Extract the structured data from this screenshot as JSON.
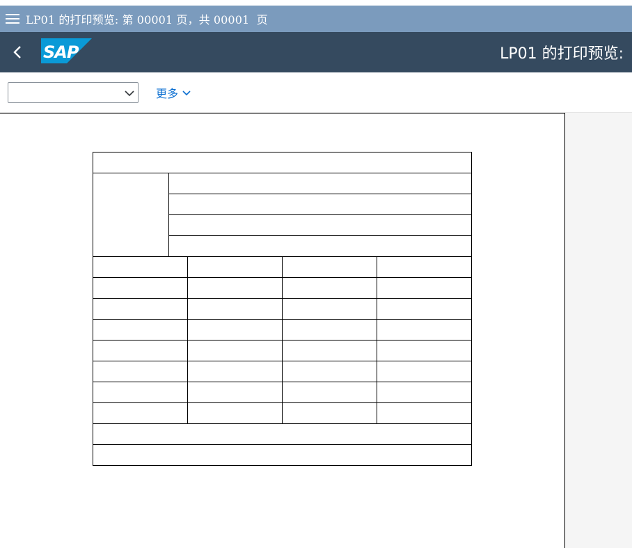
{
  "window": {
    "title": "LP01 的打印预览: 第 00001 页，共 00001  页"
  },
  "shell": {
    "logo_text": "SAP",
    "title": "LP01 的打印预览:",
    "brand_color": "#0a9ad7",
    "bar_color": "#354a5f"
  },
  "toolbar": {
    "select_value": "",
    "more_label": "更多"
  },
  "preview": {
    "form_cells": {
      "header_rows": 1,
      "side_block_rows": 4,
      "table_rows": 8,
      "table_columns": 4,
      "footer_rows": 2
    }
  },
  "icons": {
    "menu": "hamburger-menu-icon",
    "back": "back-arrow-icon",
    "dropdown": "chevron-down-icon"
  }
}
